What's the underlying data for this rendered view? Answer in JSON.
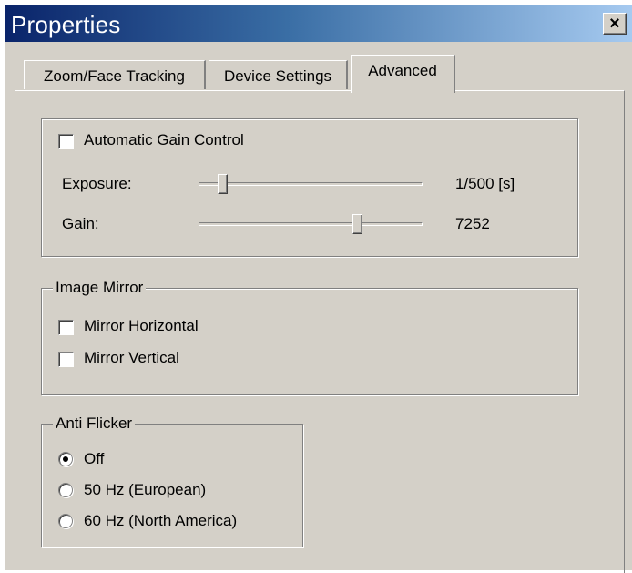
{
  "window": {
    "title": "Properties",
    "close_glyph": "×"
  },
  "tabs": [
    {
      "label": "Zoom/Face Tracking",
      "active": false
    },
    {
      "label": "Device Settings",
      "active": false
    },
    {
      "label": "Advanced",
      "active": true
    }
  ],
  "gain_group": {
    "agc_label": "Automatic Gain Control",
    "agc_checked": false,
    "exposure": {
      "label": "Exposure:",
      "value_text": "1/500 [s]",
      "slider_fraction": 0.09
    },
    "gain": {
      "label": "Gain:",
      "value_text": "7252",
      "slider_fraction": 0.72
    }
  },
  "image_mirror": {
    "title": "Image Mirror",
    "options": [
      {
        "label": "Mirror Horizontal",
        "checked": false
      },
      {
        "label": "Mirror Vertical",
        "checked": false
      }
    ]
  },
  "anti_flicker": {
    "title": "Anti Flicker",
    "options": [
      {
        "label": "Off",
        "selected": true
      },
      {
        "label": "50 Hz (European)",
        "selected": false
      },
      {
        "label": "60 Hz (North America)",
        "selected": false
      }
    ]
  },
  "colors": {
    "face": "#d4d0c8",
    "titlebar_start": "#0a246a",
    "titlebar_end": "#a6caf0"
  }
}
